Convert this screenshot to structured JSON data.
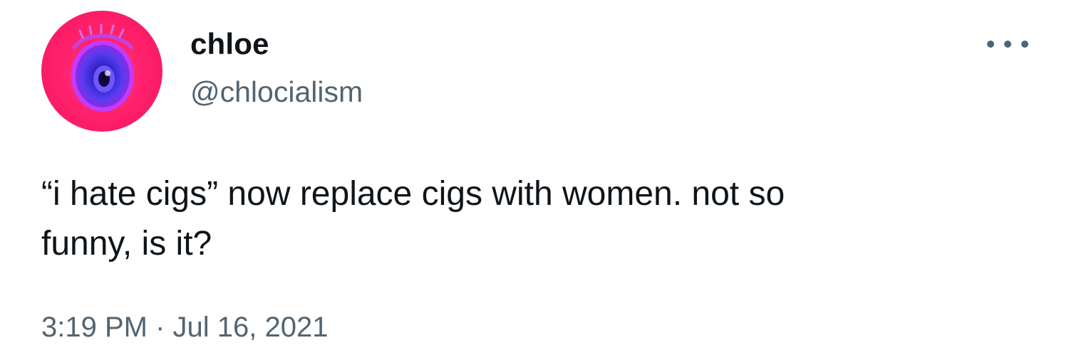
{
  "author": {
    "display_name": "chloe",
    "handle": "@chlocialism",
    "avatar_icon": "eye-avatar-icon"
  },
  "menu": {
    "icon": "more-icon"
  },
  "tweet": {
    "text": "“i hate cigs” now replace cigs with women. not so\nfunny, is it?",
    "timestamp": "3:19 PM · Jul 16, 2021"
  },
  "colors": {
    "avatar_background": "#ff1f6a",
    "secondary_text": "#536471",
    "primary_text": "#0f1419"
  }
}
